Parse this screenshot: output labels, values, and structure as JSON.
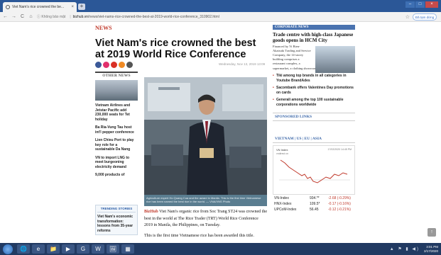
{
  "browser": {
    "tab_title": "Viet Nam's rice crowned the be...",
    "tab_close": "×",
    "new_tab": "+",
    "nav": {
      "back": "←",
      "forward": "→",
      "reload": "C",
      "home": "⌂"
    },
    "security": "ⓘ Không bảo mật",
    "domain": "bizhub.vn",
    "url_path": "/news/viet-nams-rice-crowned-the-best-at-2019-world-rice-conference_310902.html",
    "profile_label": "Đã tạm dừng",
    "window_controls": [
      "–",
      "□",
      "×"
    ]
  },
  "article": {
    "section": "NEWS",
    "title": "Viet Nam's rice crowned the best at 2019 World Rice Conference",
    "date": "Wednesday, Nov 13, 2019 13:09",
    "social_colors": [
      "#3b5998",
      "#e1306c",
      "#d93025",
      "#f08a24",
      "#555555"
    ],
    "caption": "Agriculture expert Ho Quang Cua and the award in Manila. This is the first time Vietnamese rice has been named the best rice in the world. — VNA/VNS Photo",
    "dateline": "BizHub",
    "paragraphs": [
      "Viet Nam's organic rice from Soc Trang ST24 was crowned the best in the world at The Rice Trader (TRT) World Rice Conference 2019 in Manila, the Philippines, on Tuesday.",
      "This is the first time Vietnamese rice has been awarded this title."
    ]
  },
  "other_news": {
    "heading": "OTHER NEWS",
    "items": [
      "Vietnam Airlines and Jetstar Pacific add 230,000 seats for Tet holiday",
      "Ba Ria-Vung Tau host int'l pepper conference",
      "Lien Chieu Port to play key role for a sustainable Da Nang",
      "VN to import LNG to meet burgeoning electricity demand",
      "9,000 products of"
    ]
  },
  "trending": {
    "heading": "TRENDING STORIES",
    "items": [
      "Viet Nam's economic transformation: lessons from 35-year reforms"
    ]
  },
  "right": {
    "section": "CORPORATE NEWS",
    "feature_title": "Trade centre with high-class Japanese goods opens in HCM City",
    "feature_text": "Financed by Vi Bien-Akatsuki Trading and Service Company, the 14-storey building comprises a restaurant complex, a",
    "feature_text_full": "supermarket, a clothing showroom and an entertainment area.",
    "bullets": [
      "Tiki among top brands in all categories in Youtube BrandAdes",
      "Sacombank offers Valentines Day promotions on cards",
      "Generali among the top 100 sustainable corporations worldwide"
    ],
    "sponsored": "SPONSORED LINKS",
    "stock_tabs": "VIETNAM | US | EU | ASIA",
    "chart_label": "VN Index",
    "chart_sub": "vndirect.vn",
    "chart_time": "17/02/2020 14:45 PM",
    "indices": [
      {
        "name": "VN-Index",
        "value": "934.**",
        "change": "-2.68 (-0.29%)"
      },
      {
        "name": "HNX-Index",
        "value": "109.5*",
        "change": "-0.17 (-0.16%)"
      },
      {
        "name": "UPCoM-Index",
        "value": "56.45",
        "change": "-0.12 (-0.21%)"
      }
    ]
  },
  "misc": {
    "to_top": "↑"
  },
  "taskbar": {
    "apps": [
      "🌐",
      "e",
      "📁",
      "▶",
      "G",
      "W",
      "🖼",
      "▦"
    ],
    "tray_icons": "▲ ⚑ ▮ ◀)",
    "time": "3:01 PM",
    "date": "2/17/2020"
  }
}
